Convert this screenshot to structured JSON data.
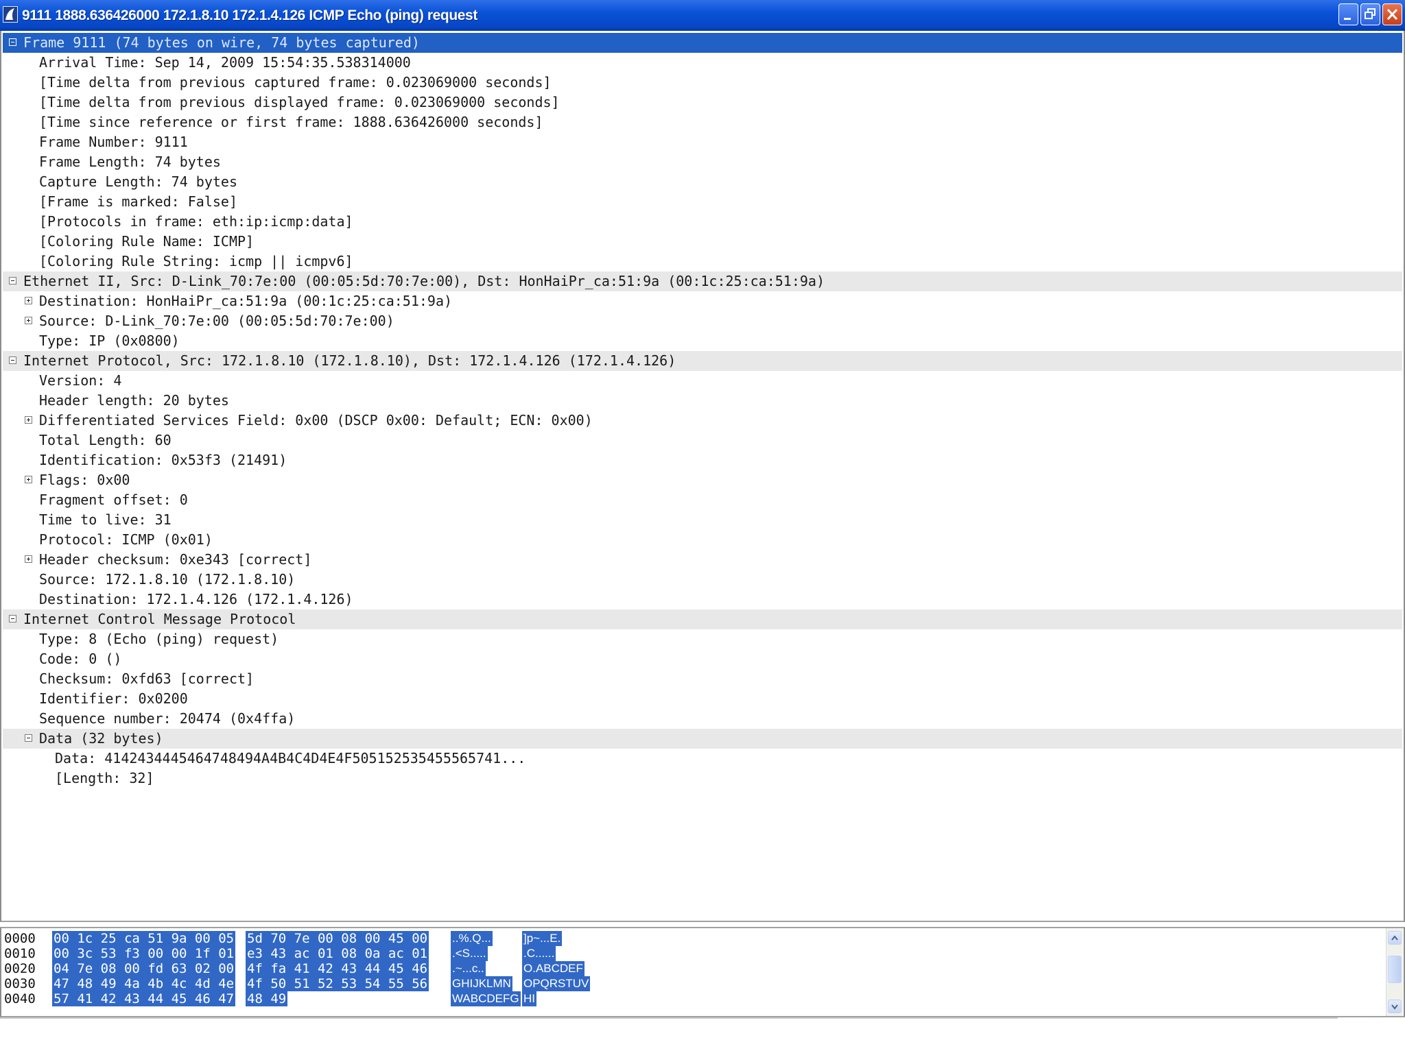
{
  "window": {
    "title": "9111 1888.636426000 172.1.8.10 172.1.4.126 ICMP Echo (ping) request",
    "icon": "wireshark-fin-icon",
    "accent": "#0a52d8",
    "selection_color": "#2160c4"
  },
  "tree": [
    {
      "text": "Frame 9111 (74 bytes on wire, 74 bytes captured)",
      "level": 0,
      "toggle": "minus",
      "kind": "sel"
    },
    {
      "text": "Arrival Time: Sep 14, 2009 15:54:35.538314000",
      "level": 1,
      "toggle": "",
      "kind": ""
    },
    {
      "text": "[Time delta from previous captured frame: 0.023069000 seconds]",
      "level": 1,
      "toggle": "",
      "kind": ""
    },
    {
      "text": "[Time delta from previous displayed frame: 0.023069000 seconds]",
      "level": 1,
      "toggle": "",
      "kind": ""
    },
    {
      "text": "[Time since reference or first frame: 1888.636426000 seconds]",
      "level": 1,
      "toggle": "",
      "kind": ""
    },
    {
      "text": "Frame Number: 9111",
      "level": 1,
      "toggle": "",
      "kind": ""
    },
    {
      "text": "Frame Length: 74 bytes",
      "level": 1,
      "toggle": "",
      "kind": ""
    },
    {
      "text": "Capture Length: 74 bytes",
      "level": 1,
      "toggle": "",
      "kind": ""
    },
    {
      "text": "[Frame is marked: False]",
      "level": 1,
      "toggle": "",
      "kind": ""
    },
    {
      "text": "[Protocols in frame: eth:ip:icmp:data]",
      "level": 1,
      "toggle": "",
      "kind": ""
    },
    {
      "text": "[Coloring Rule Name: ICMP]",
      "level": 1,
      "toggle": "",
      "kind": ""
    },
    {
      "text": "[Coloring Rule String: icmp || icmpv6]",
      "level": 1,
      "toggle": "",
      "kind": ""
    },
    {
      "text": "Ethernet II, Src: D-Link_70:7e:00 (00:05:5d:70:7e:00), Dst: HonHaiPr_ca:51:9a (00:1c:25:ca:51:9a)",
      "level": 0,
      "toggle": "minus",
      "kind": "head"
    },
    {
      "text": "Destination: HonHaiPr_ca:51:9a (00:1c:25:ca:51:9a)",
      "level": 1,
      "toggle": "plus",
      "kind": ""
    },
    {
      "text": "Source: D-Link_70:7e:00 (00:05:5d:70:7e:00)",
      "level": 1,
      "toggle": "plus",
      "kind": ""
    },
    {
      "text": "Type: IP (0x0800)",
      "level": 1,
      "toggle": "",
      "kind": ""
    },
    {
      "text": "Internet Protocol, Src: 172.1.8.10 (172.1.8.10), Dst: 172.1.4.126 (172.1.4.126)",
      "level": 0,
      "toggle": "minus",
      "kind": "head"
    },
    {
      "text": "Version: 4",
      "level": 1,
      "toggle": "",
      "kind": ""
    },
    {
      "text": "Header length: 20 bytes",
      "level": 1,
      "toggle": "",
      "kind": ""
    },
    {
      "text": "Differentiated Services Field: 0x00 (DSCP 0x00: Default; ECN: 0x00)",
      "level": 1,
      "toggle": "plus",
      "kind": ""
    },
    {
      "text": "Total Length: 60",
      "level": 1,
      "toggle": "",
      "kind": ""
    },
    {
      "text": "Identification: 0x53f3 (21491)",
      "level": 1,
      "toggle": "",
      "kind": ""
    },
    {
      "text": "Flags: 0x00",
      "level": 1,
      "toggle": "plus",
      "kind": ""
    },
    {
      "text": "Fragment offset: 0",
      "level": 1,
      "toggle": "",
      "kind": ""
    },
    {
      "text": "Time to live: 31",
      "level": 1,
      "toggle": "",
      "kind": ""
    },
    {
      "text": "Protocol: ICMP (0x01)",
      "level": 1,
      "toggle": "",
      "kind": ""
    },
    {
      "text": "Header checksum: 0xe343 [correct]",
      "level": 1,
      "toggle": "plus",
      "kind": ""
    },
    {
      "text": "Source: 172.1.8.10 (172.1.8.10)",
      "level": 1,
      "toggle": "",
      "kind": ""
    },
    {
      "text": "Destination: 172.1.4.126 (172.1.4.126)",
      "level": 1,
      "toggle": "",
      "kind": ""
    },
    {
      "text": "Internet Control Message Protocol",
      "level": 0,
      "toggle": "minus",
      "kind": "head"
    },
    {
      "text": "Type: 8 (Echo (ping) request)",
      "level": 1,
      "toggle": "",
      "kind": ""
    },
    {
      "text": "Code: 0 ()",
      "level": 1,
      "toggle": "",
      "kind": ""
    },
    {
      "text": "Checksum: 0xfd63 [correct]",
      "level": 1,
      "toggle": "",
      "kind": ""
    },
    {
      "text": "Identifier: 0x0200",
      "level": 1,
      "toggle": "",
      "kind": ""
    },
    {
      "text": "Sequence number: 20474 (0x4ffa)",
      "level": 1,
      "toggle": "",
      "kind": ""
    },
    {
      "text": "Data (32 bytes)",
      "level": 1,
      "toggle": "minus",
      "kind": "head"
    },
    {
      "text": "Data: 4142434445464748494A4B4C4D4E4F505152535455565741...",
      "level": 2,
      "toggle": "",
      "kind": ""
    },
    {
      "text": "[Length: 32]",
      "level": 2,
      "toggle": "",
      "kind": ""
    }
  ],
  "hex": [
    {
      "offset": "0000",
      "a": "00 1c 25 ca 51 9a 00 05",
      "b": "5d 70 7e 00 08 00 45 00",
      "asc_a": "..%.Q...",
      "asc_b": "]p~...E."
    },
    {
      "offset": "0010",
      "a": "00 3c 53 f3 00 00 1f 01",
      "b": "e3 43 ac 01 08 0a ac 01",
      "asc_a": ".<S.....",
      "asc_b": ".C......"
    },
    {
      "offset": "0020",
      "a": "04 7e 08 00 fd 63 02 00",
      "b": "4f fa 41 42 43 44 45 46",
      "asc_a": ".~...c..",
      "asc_b": "O.ABCDEF"
    },
    {
      "offset": "0030",
      "a": "47 48 49 4a 4b 4c 4d 4e",
      "b": "4f 50 51 52 53 54 55 56",
      "asc_a": "GHIJKLMN",
      "asc_b": "OPQRSTUV"
    },
    {
      "offset": "0040",
      "a": "57 41 42 43 44 45 46 47",
      "b": "48 49",
      "asc_a": "WABCDEFG",
      "asc_b": "HI"
    }
  ]
}
